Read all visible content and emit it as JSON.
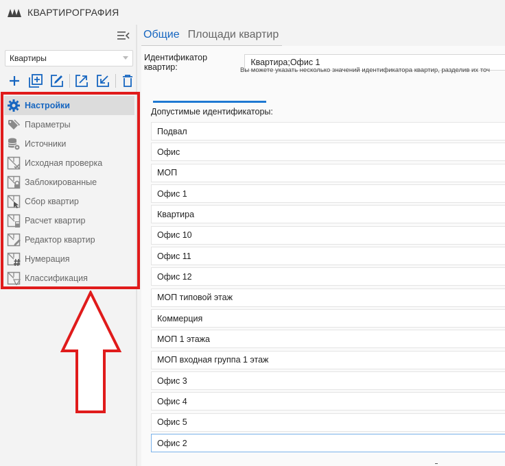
{
  "app": {
    "title": "КВАРТИРОГРАФИЯ",
    "logo_icon": "m-logo-icon"
  },
  "sidebar": {
    "project_select": {
      "value": "Квартиры"
    },
    "toolbar": [
      {
        "name": "add-button",
        "icon": "plus-icon"
      },
      {
        "name": "add-copy-button",
        "icon": "add-box-icon"
      },
      {
        "name": "edit-button",
        "icon": "edit-icon"
      },
      {
        "name": "export-button",
        "icon": "export-icon"
      },
      {
        "name": "import-button",
        "icon": "import-icon"
      },
      {
        "name": "delete-button",
        "icon": "trash-icon"
      }
    ],
    "items": [
      {
        "label": "Настройки",
        "icon": "gear-icon",
        "active": true
      },
      {
        "label": "Параметры",
        "icon": "tags-icon"
      },
      {
        "label": "Источники",
        "icon": "database-gear-icon"
      },
      {
        "label": "Исходная проверка",
        "icon": "check-plan-icon"
      },
      {
        "label": "Заблокированные",
        "icon": "lock-plan-icon"
      },
      {
        "label": "Сбор квартир",
        "icon": "cursor-plan-icon"
      },
      {
        "label": "Расчет квартир",
        "icon": "calc-plan-icon"
      },
      {
        "label": "Редактор квартир",
        "icon": "pencil-plan-icon"
      },
      {
        "label": "Нумерация",
        "icon": "hash-plan-icon"
      },
      {
        "label": "Классификация",
        "icon": "classify-plan-icon"
      }
    ]
  },
  "main": {
    "tabs": [
      {
        "label": "Общие",
        "active": true
      },
      {
        "label": "Площади квартир"
      }
    ],
    "id_label": "Идентификатор квартир:",
    "id_value": "Квартира;Офис 1",
    "hint": "Вы можете указать несколько значений идентификатора квартир, разделив их точ",
    "allowed_label": "Допустимые идентификаторы:",
    "allowed": [
      "Подвал",
      "Офис",
      "МОП",
      "Офис 1",
      "Квартира",
      "Офис 10",
      "Офис 11",
      "Офис 12",
      "МОП типовой этаж",
      "Коммерция",
      "МОП 1 этажа",
      "МОП входная группа 1 этаж",
      "Офис 3",
      "Офис 4",
      "Офис 5",
      "Офис 2"
    ],
    "selected_index": 15
  },
  "colors": {
    "accent": "#1565c0",
    "highlight": "#e01b1b",
    "progress": "#1e78d2"
  }
}
